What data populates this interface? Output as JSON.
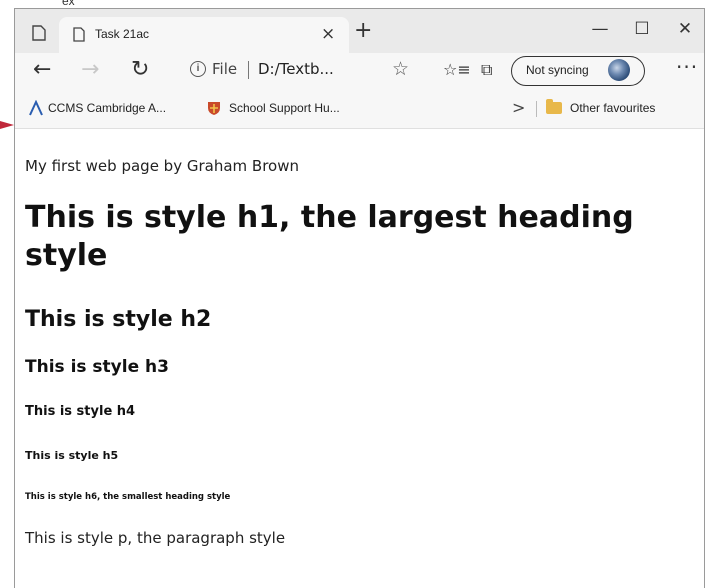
{
  "caption": {
    "text": "ex"
  },
  "browser": {
    "tab": {
      "title": "Task 21ac",
      "close": "×"
    },
    "new_tab": "+",
    "window_controls": {
      "minimize": "—",
      "maximize": "☐",
      "close": "✕"
    },
    "toolbar": {
      "back": "←",
      "forward": "→",
      "refresh": "↻",
      "address_label": "File",
      "address_url": "D:/Textb...",
      "favorite_star": "☆",
      "favorites": "☆≡",
      "collections": "⧉",
      "sync_label": "Not syncing",
      "more": "···"
    },
    "bookmarks": {
      "items": [
        {
          "label": "CCMS Cambridge A...",
          "icon": "ccms-logo-icon"
        },
        {
          "label": "School Support Hu...",
          "icon": "school-shield-icon"
        }
      ],
      "chevron": ">",
      "other_label": "Other favourites"
    },
    "colors": {
      "titlebar": "#eaeaea",
      "toolbar": "#f7f7f7",
      "pointer": "#c0283a",
      "folder": "#e8b84a"
    }
  },
  "page": {
    "intro": "My first web page by Graham Brown",
    "h1": "This is style h1, the largest heading style",
    "h2": "This is style h2",
    "h3": "This is style h3",
    "h4": "This is style h4",
    "h5": "This is style h5",
    "h6": "This is style h6, the smallest heading style",
    "p": "This is style p, the paragraph style"
  }
}
